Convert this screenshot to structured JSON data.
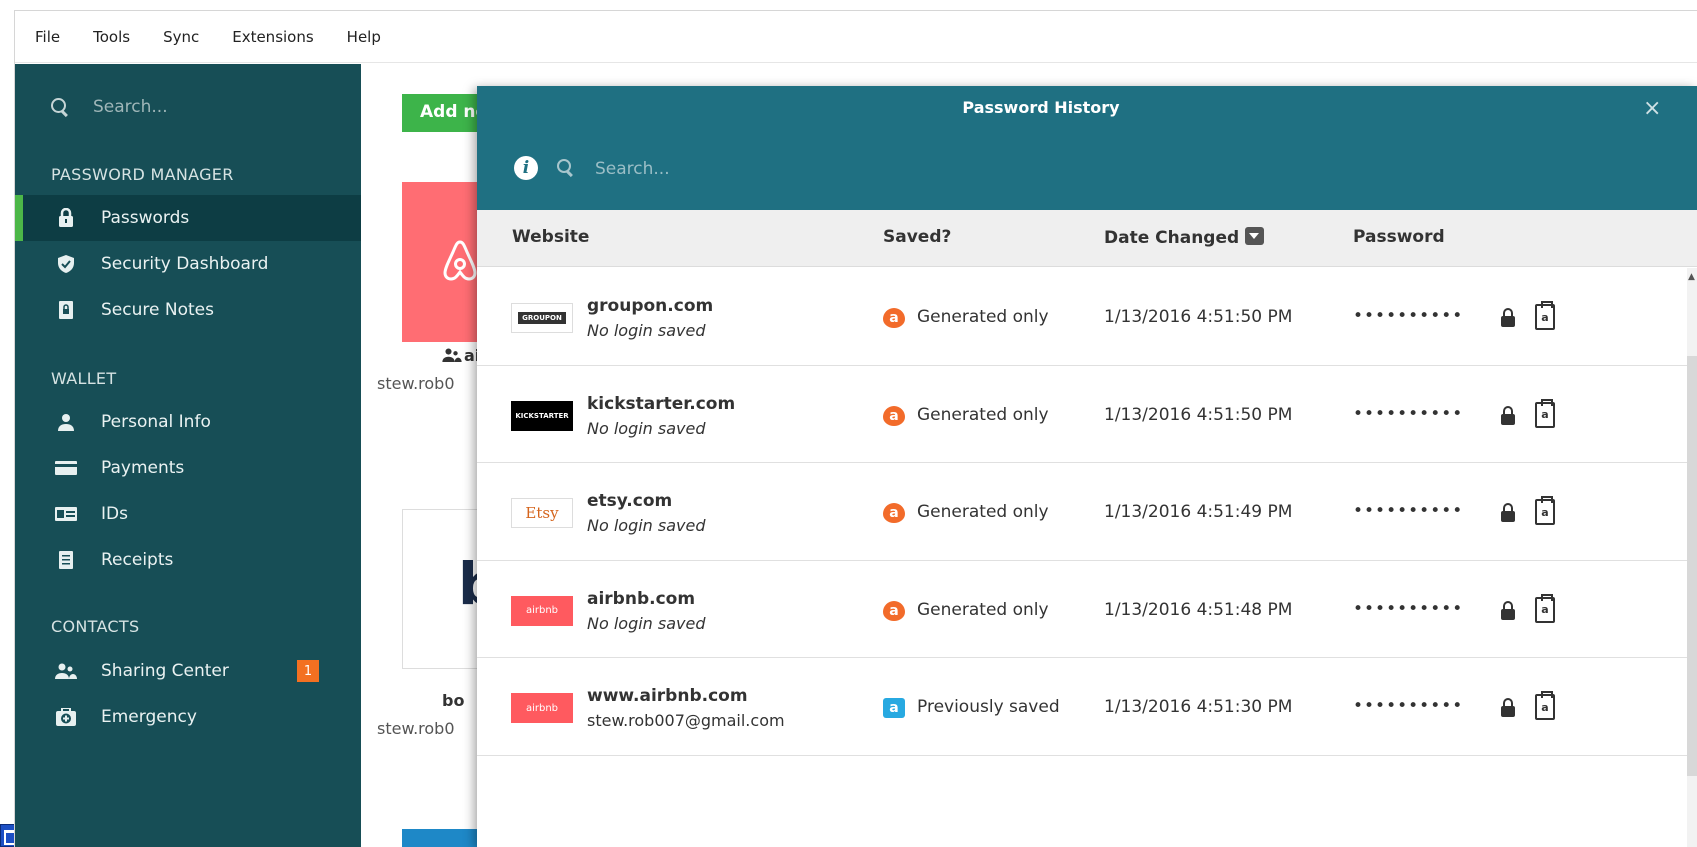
{
  "menubar": {
    "items": [
      "File",
      "Tools",
      "Sync",
      "Extensions",
      "Help"
    ]
  },
  "sidebar": {
    "search_placeholder": "Search...",
    "sections": {
      "password_manager": "PASSWORD MANAGER",
      "wallet": "WALLET",
      "contacts": "CONTACTS"
    },
    "items": [
      {
        "label": "Passwords",
        "icon": "lock-icon",
        "active": true
      },
      {
        "label": "Security Dashboard",
        "icon": "shield-icon"
      },
      {
        "label": "Secure Notes",
        "icon": "note-lock-icon"
      },
      {
        "label": "Personal Info",
        "icon": "person-icon"
      },
      {
        "label": "Payments",
        "icon": "credit-card-icon"
      },
      {
        "label": "IDs",
        "icon": "id-card-icon"
      },
      {
        "label": "Receipts",
        "icon": "receipt-icon"
      },
      {
        "label": "Sharing Center",
        "icon": "people-icon",
        "badge": "1"
      },
      {
        "label": "Emergency",
        "icon": "first-aid-icon"
      }
    ]
  },
  "main": {
    "add_new_label": "Add ne",
    "tiles": [
      {
        "title": "ai",
        "user": "stew.rob0"
      },
      {
        "title": "bo",
        "user": "stew.rob0"
      }
    ]
  },
  "dialog": {
    "title": "Password History",
    "close": "×",
    "search_placeholder": "Search...",
    "columns": {
      "website": "Website",
      "saved": "Saved?",
      "date": "Date Changed",
      "password": "Password"
    },
    "rows": [
      {
        "site": "groupon.com",
        "sub": "No login saved",
        "logo": "GROUPON",
        "saved": "Generated only",
        "date": "1/13/2016 4:51:50 PM",
        "password": "••••••••••"
      },
      {
        "site": "kickstarter.com",
        "sub": "No login saved",
        "logo": "KICKSTARTER",
        "saved": "Generated only",
        "date": "1/13/2016 4:51:50 PM",
        "password": "••••••••••"
      },
      {
        "site": "etsy.com",
        "sub": "No login saved",
        "logo": "Etsy",
        "saved": "Generated only",
        "date": "1/13/2016 4:51:49 PM",
        "password": "••••••••••"
      },
      {
        "site": "airbnb.com",
        "sub": "No login saved",
        "logo": "airbnb",
        "saved": "Generated only",
        "date": "1/13/2016 4:51:48 PM",
        "password": "••••••••••"
      },
      {
        "site": "www.airbnb.com",
        "sub": "stew.rob007@gmail.com",
        "logo": "airbnb",
        "saved": "Previously saved",
        "date": "1/13/2016 4:51:30 PM",
        "password": "••••••••••"
      }
    ]
  },
  "colors": {
    "sidebar": "#174e56",
    "dialog_header": "#1f7082",
    "accent_green": "#3db44a",
    "generated": "#f26b2a",
    "saved": "#27a9e1",
    "badge": "#f37021"
  }
}
